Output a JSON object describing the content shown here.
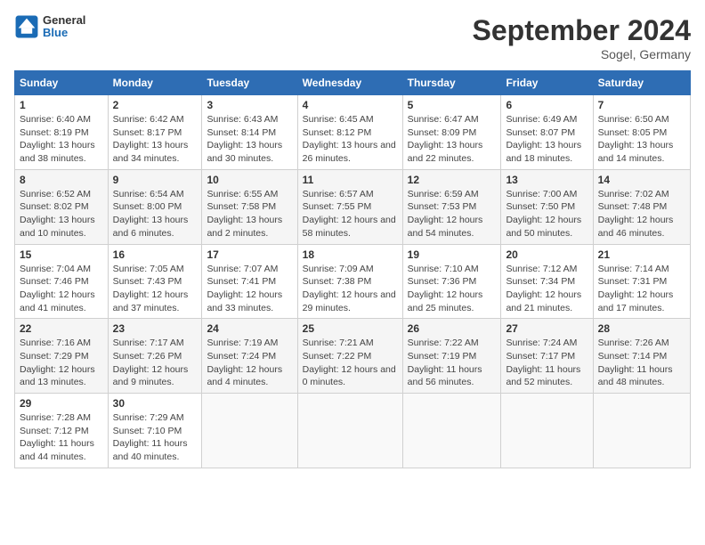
{
  "header": {
    "logo_general": "General",
    "logo_blue": "Blue",
    "month_title": "September 2024",
    "location": "Sogel, Germany"
  },
  "columns": [
    "Sunday",
    "Monday",
    "Tuesday",
    "Wednesday",
    "Thursday",
    "Friday",
    "Saturday"
  ],
  "weeks": [
    [
      {
        "day": "1",
        "sunrise": "Sunrise: 6:40 AM",
        "sunset": "Sunset: 8:19 PM",
        "daylight": "Daylight: 13 hours and 38 minutes."
      },
      {
        "day": "2",
        "sunrise": "Sunrise: 6:42 AM",
        "sunset": "Sunset: 8:17 PM",
        "daylight": "Daylight: 13 hours and 34 minutes."
      },
      {
        "day": "3",
        "sunrise": "Sunrise: 6:43 AM",
        "sunset": "Sunset: 8:14 PM",
        "daylight": "Daylight: 13 hours and 30 minutes."
      },
      {
        "day": "4",
        "sunrise": "Sunrise: 6:45 AM",
        "sunset": "Sunset: 8:12 PM",
        "daylight": "Daylight: 13 hours and 26 minutes."
      },
      {
        "day": "5",
        "sunrise": "Sunrise: 6:47 AM",
        "sunset": "Sunset: 8:09 PM",
        "daylight": "Daylight: 13 hours and 22 minutes."
      },
      {
        "day": "6",
        "sunrise": "Sunrise: 6:49 AM",
        "sunset": "Sunset: 8:07 PM",
        "daylight": "Daylight: 13 hours and 18 minutes."
      },
      {
        "day": "7",
        "sunrise": "Sunrise: 6:50 AM",
        "sunset": "Sunset: 8:05 PM",
        "daylight": "Daylight: 13 hours and 14 minutes."
      }
    ],
    [
      {
        "day": "8",
        "sunrise": "Sunrise: 6:52 AM",
        "sunset": "Sunset: 8:02 PM",
        "daylight": "Daylight: 13 hours and 10 minutes."
      },
      {
        "day": "9",
        "sunrise": "Sunrise: 6:54 AM",
        "sunset": "Sunset: 8:00 PM",
        "daylight": "Daylight: 13 hours and 6 minutes."
      },
      {
        "day": "10",
        "sunrise": "Sunrise: 6:55 AM",
        "sunset": "Sunset: 7:58 PM",
        "daylight": "Daylight: 13 hours and 2 minutes."
      },
      {
        "day": "11",
        "sunrise": "Sunrise: 6:57 AM",
        "sunset": "Sunset: 7:55 PM",
        "daylight": "Daylight: 12 hours and 58 minutes."
      },
      {
        "day": "12",
        "sunrise": "Sunrise: 6:59 AM",
        "sunset": "Sunset: 7:53 PM",
        "daylight": "Daylight: 12 hours and 54 minutes."
      },
      {
        "day": "13",
        "sunrise": "Sunrise: 7:00 AM",
        "sunset": "Sunset: 7:50 PM",
        "daylight": "Daylight: 12 hours and 50 minutes."
      },
      {
        "day": "14",
        "sunrise": "Sunrise: 7:02 AM",
        "sunset": "Sunset: 7:48 PM",
        "daylight": "Daylight: 12 hours and 46 minutes."
      }
    ],
    [
      {
        "day": "15",
        "sunrise": "Sunrise: 7:04 AM",
        "sunset": "Sunset: 7:46 PM",
        "daylight": "Daylight: 12 hours and 41 minutes."
      },
      {
        "day": "16",
        "sunrise": "Sunrise: 7:05 AM",
        "sunset": "Sunset: 7:43 PM",
        "daylight": "Daylight: 12 hours and 37 minutes."
      },
      {
        "day": "17",
        "sunrise": "Sunrise: 7:07 AM",
        "sunset": "Sunset: 7:41 PM",
        "daylight": "Daylight: 12 hours and 33 minutes."
      },
      {
        "day": "18",
        "sunrise": "Sunrise: 7:09 AM",
        "sunset": "Sunset: 7:38 PM",
        "daylight": "Daylight: 12 hours and 29 minutes."
      },
      {
        "day": "19",
        "sunrise": "Sunrise: 7:10 AM",
        "sunset": "Sunset: 7:36 PM",
        "daylight": "Daylight: 12 hours and 25 minutes."
      },
      {
        "day": "20",
        "sunrise": "Sunrise: 7:12 AM",
        "sunset": "Sunset: 7:34 PM",
        "daylight": "Daylight: 12 hours and 21 minutes."
      },
      {
        "day": "21",
        "sunrise": "Sunrise: 7:14 AM",
        "sunset": "Sunset: 7:31 PM",
        "daylight": "Daylight: 12 hours and 17 minutes."
      }
    ],
    [
      {
        "day": "22",
        "sunrise": "Sunrise: 7:16 AM",
        "sunset": "Sunset: 7:29 PM",
        "daylight": "Daylight: 12 hours and 13 minutes."
      },
      {
        "day": "23",
        "sunrise": "Sunrise: 7:17 AM",
        "sunset": "Sunset: 7:26 PM",
        "daylight": "Daylight: 12 hours and 9 minutes."
      },
      {
        "day": "24",
        "sunrise": "Sunrise: 7:19 AM",
        "sunset": "Sunset: 7:24 PM",
        "daylight": "Daylight: 12 hours and 4 minutes."
      },
      {
        "day": "25",
        "sunrise": "Sunrise: 7:21 AM",
        "sunset": "Sunset: 7:22 PM",
        "daylight": "Daylight: 12 hours and 0 minutes."
      },
      {
        "day": "26",
        "sunrise": "Sunrise: 7:22 AM",
        "sunset": "Sunset: 7:19 PM",
        "daylight": "Daylight: 11 hours and 56 minutes."
      },
      {
        "day": "27",
        "sunrise": "Sunrise: 7:24 AM",
        "sunset": "Sunset: 7:17 PM",
        "daylight": "Daylight: 11 hours and 52 minutes."
      },
      {
        "day": "28",
        "sunrise": "Sunrise: 7:26 AM",
        "sunset": "Sunset: 7:14 PM",
        "daylight": "Daylight: 11 hours and 48 minutes."
      }
    ],
    [
      {
        "day": "29",
        "sunrise": "Sunrise: 7:28 AM",
        "sunset": "Sunset: 7:12 PM",
        "daylight": "Daylight: 11 hours and 44 minutes."
      },
      {
        "day": "30",
        "sunrise": "Sunrise: 7:29 AM",
        "sunset": "Sunset: 7:10 PM",
        "daylight": "Daylight: 11 hours and 40 minutes."
      },
      null,
      null,
      null,
      null,
      null
    ]
  ]
}
